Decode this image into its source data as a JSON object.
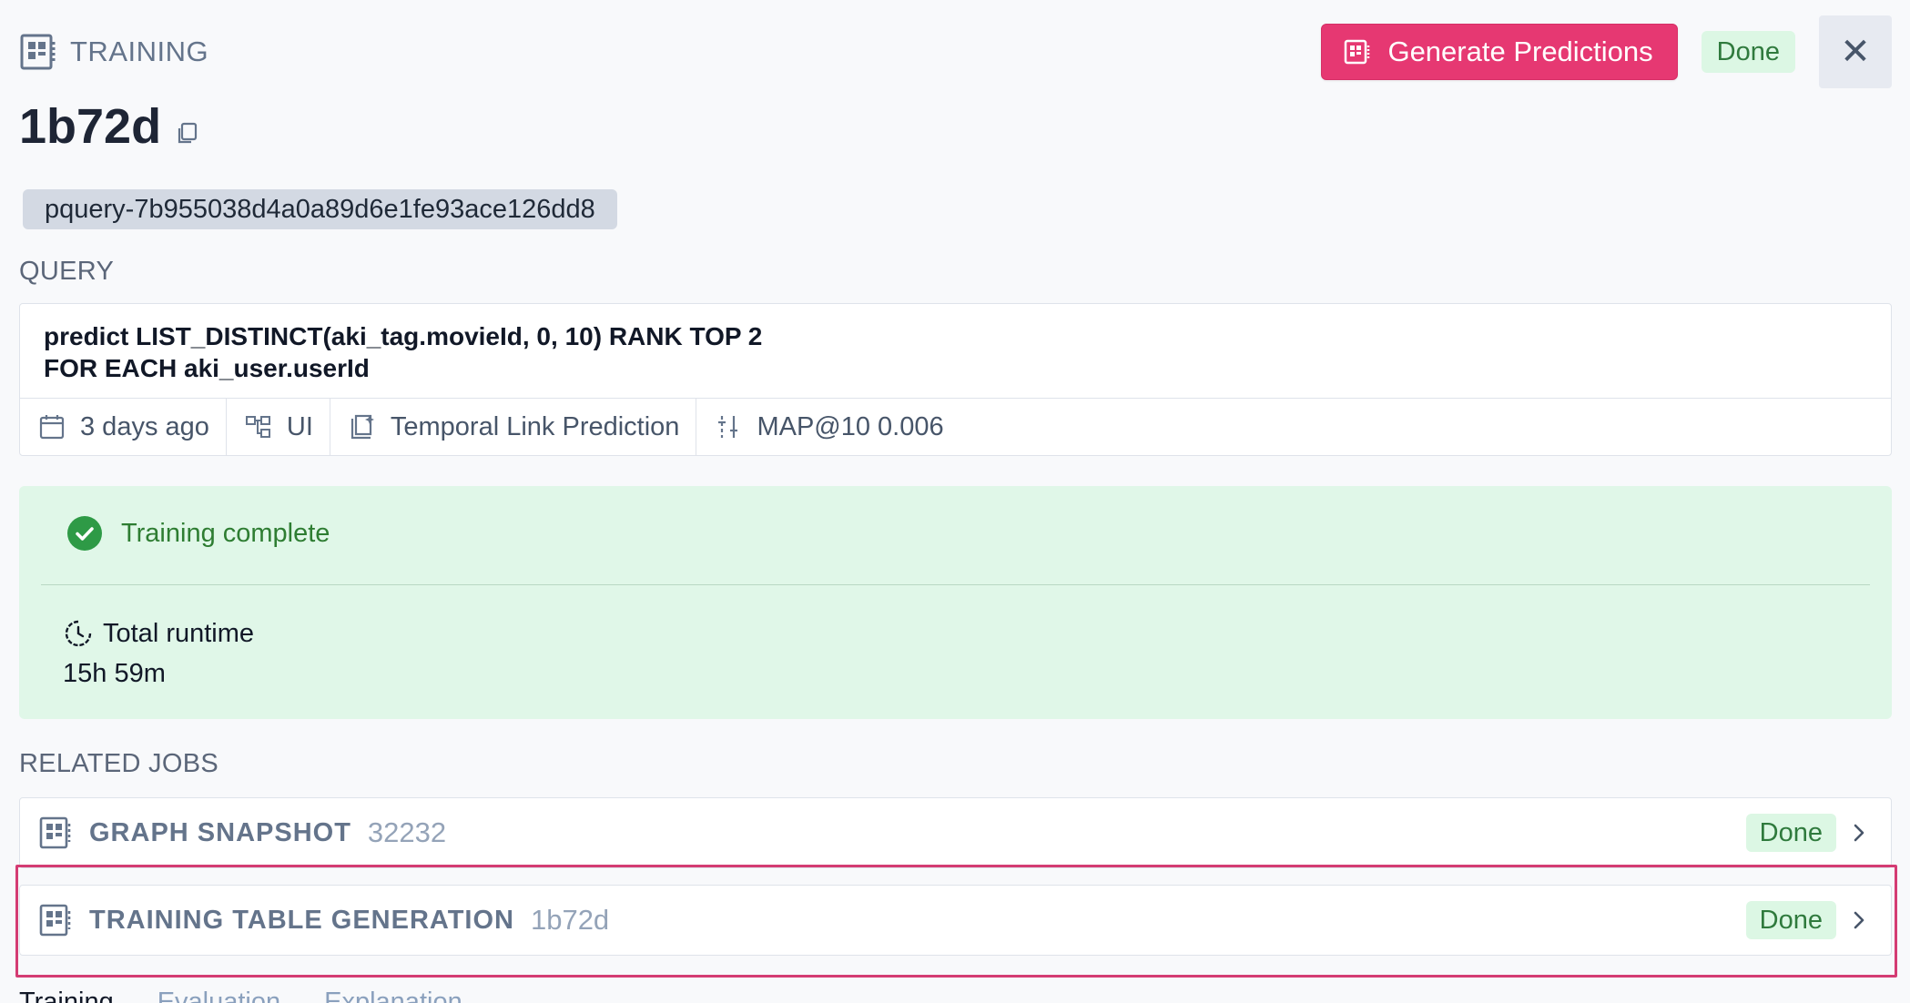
{
  "header": {
    "kind_label": "TRAINING",
    "generate_button_label": "Generate Predictions",
    "status": "Done",
    "close_symbol": "✕"
  },
  "title": "1b72d",
  "pquery_id": "pquery-7b955038d4a0a89d6e1fe93ace126dd8",
  "query_section": {
    "label": "QUERY",
    "text": "predict LIST_DISTINCT(aki_tag.movieId, 0, 10) RANK TOP 2\nFOR EACH aki_user.userId",
    "meta": [
      {
        "icon": "calendar-icon",
        "label": "3 days ago"
      },
      {
        "icon": "flow-icon",
        "label": "UI"
      },
      {
        "icon": "task-type-icon",
        "label": "Temporal Link Prediction"
      },
      {
        "icon": "metric-icon",
        "label": "MAP@10 0.006"
      }
    ]
  },
  "status_box": {
    "headline": "Training complete",
    "runtime_label": "Total runtime",
    "runtime_value": "15h 59m"
  },
  "related_jobs": {
    "label": "RELATED JOBS",
    "items": [
      {
        "type": "GRAPH SNAPSHOT",
        "id": "32232",
        "status": "Done"
      },
      {
        "type": "TRAINING TABLE GENERATION",
        "id": "1b72d",
        "status": "Done"
      }
    ]
  },
  "tabs": [
    "Training",
    "Evaluation",
    "Explanation"
  ],
  "colors": {
    "accent": "#e63872",
    "success_bg": "#e0f7e8",
    "success_text": "#2e7d32",
    "highlight": "#d43c73"
  }
}
